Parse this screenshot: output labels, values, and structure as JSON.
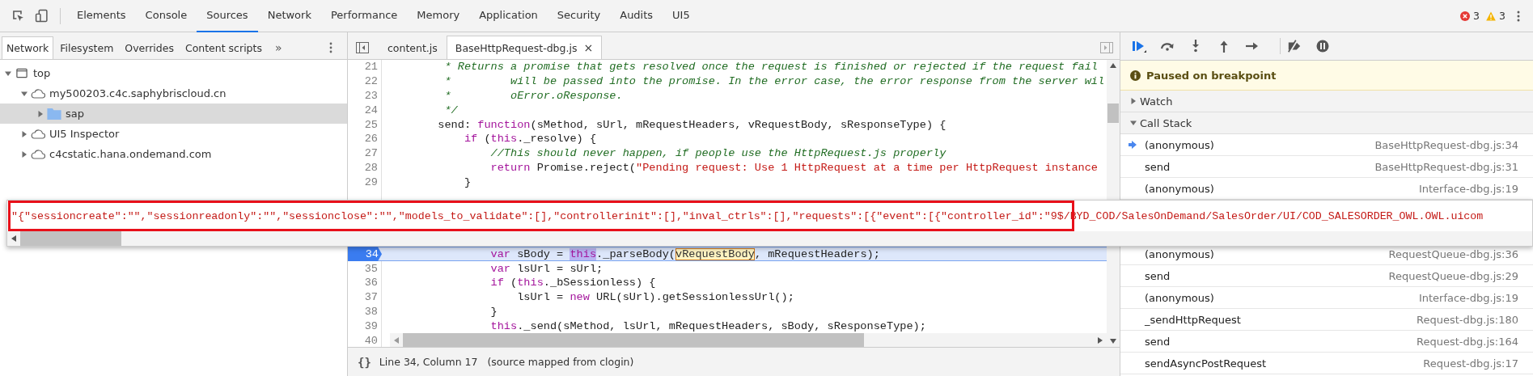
{
  "toolbar": {
    "tabs": [
      {
        "label": "Elements",
        "selected": false
      },
      {
        "label": "Console",
        "selected": false
      },
      {
        "label": "Sources",
        "selected": true
      },
      {
        "label": "Network",
        "selected": false
      },
      {
        "label": "Performance",
        "selected": false
      },
      {
        "label": "Memory",
        "selected": false
      },
      {
        "label": "Application",
        "selected": false
      },
      {
        "label": "Security",
        "selected": false
      },
      {
        "label": "Audits",
        "selected": false
      },
      {
        "label": "UI5",
        "selected": false
      }
    ],
    "errors": "3",
    "warnings": "3"
  },
  "navigator": {
    "tabs": [
      {
        "label": "Network",
        "selected": true
      },
      {
        "label": "Filesystem",
        "selected": false
      },
      {
        "label": "Overrides",
        "selected": false
      },
      {
        "label": "Content scripts",
        "selected": false
      }
    ],
    "more": "»",
    "tree": [
      {
        "label": "top",
        "kind": "frame",
        "expanded": true,
        "selected": false,
        "children": [
          {
            "label": "my500203.c4c.saphybriscloud.cn",
            "kind": "domain",
            "expanded": true,
            "selected": false,
            "children": [
              {
                "label": "sap",
                "kind": "folder",
                "expanded": false,
                "selected": true
              }
            ]
          },
          {
            "label": "UI5 Inspector",
            "kind": "domain",
            "expanded": false,
            "selected": false
          },
          {
            "label": "c4cstatic.hana.ondemand.com",
            "kind": "domain",
            "expanded": false,
            "selected": false
          }
        ]
      }
    ]
  },
  "editor": {
    "tabs": [
      {
        "label": "content.js",
        "selected": false,
        "closable": false
      },
      {
        "label": "BaseHttpRequest-dbg.js",
        "selected": true,
        "closable": true
      }
    ],
    "close": "×",
    "lines_above": [
      {
        "number": "21",
        "paused": false,
        "segments": [
          {
            "kind": "comment",
            "text": "         * Returns a promise that gets resolved once the request is finished or rejected if the request fail"
          }
        ]
      },
      {
        "number": "22",
        "paused": false,
        "segments": [
          {
            "kind": "comment",
            "text": "         *         will be passed into the promise. In the error case, the error response from the server wil"
          }
        ]
      },
      {
        "number": "23",
        "paused": false,
        "segments": [
          {
            "kind": "comment",
            "text": "         *         oError.oResponse."
          }
        ]
      },
      {
        "number": "24",
        "paused": false,
        "segments": [
          {
            "kind": "comment",
            "text": "         */"
          }
        ]
      },
      {
        "number": "25",
        "paused": false,
        "segments": [
          {
            "kind": "plain",
            "text": "        send: "
          },
          {
            "kind": "keyword",
            "text": "function"
          },
          {
            "kind": "plain",
            "text": "(sMethod, sUrl, mRequestHeaders, vRequestBody, sResponseType) {"
          }
        ]
      },
      {
        "number": "26",
        "paused": false,
        "segments": [
          {
            "kind": "keyword",
            "text": "            if"
          },
          {
            "kind": "plain",
            "text": " ("
          },
          {
            "kind": "keyword",
            "text": "this"
          },
          {
            "kind": "plain",
            "text": "._resolve) {"
          }
        ]
      },
      {
        "number": "27",
        "paused": false,
        "segments": [
          {
            "kind": "comment",
            "text": "                //This should never happen, if people use the HttpRequest.js properly"
          }
        ]
      },
      {
        "number": "28",
        "paused": false,
        "segments": [
          {
            "kind": "keyword",
            "text": "                return"
          },
          {
            "kind": "plain",
            "text": " Promise.reject("
          },
          {
            "kind": "string",
            "text": "\"Pending request: Use 1 HttpRequest at a time per HttpRequest instance"
          }
        ]
      },
      {
        "number": "29",
        "paused": false,
        "segments": [
          {
            "kind": "plain",
            "text": "            }"
          }
        ]
      }
    ],
    "lines_below": [
      {
        "number": "34",
        "paused": true,
        "segments": [
          {
            "kind": "keyword",
            "text": "                var"
          },
          {
            "kind": "plain",
            "text": " sBody = "
          },
          {
            "kind": "match",
            "text": "this"
          },
          {
            "kind": "plain",
            "text": "._parseBody("
          },
          {
            "kind": "hover",
            "text": "vRequestBody"
          },
          {
            "kind": "plain",
            "text": ", mRequestHeaders);"
          }
        ]
      },
      {
        "number": "35",
        "paused": false,
        "segments": [
          {
            "kind": "keyword",
            "text": "                var"
          },
          {
            "kind": "plain",
            "text": " lsUrl = sUrl;"
          }
        ]
      },
      {
        "number": "36",
        "paused": false,
        "segments": [
          {
            "kind": "keyword",
            "text": "                if"
          },
          {
            "kind": "plain",
            "text": " ("
          },
          {
            "kind": "keyword",
            "text": "this"
          },
          {
            "kind": "plain",
            "text": "._bSessionless) {"
          }
        ]
      },
      {
        "number": "37",
        "paused": false,
        "segments": [
          {
            "kind": "plain",
            "text": "                    lsUrl = "
          },
          {
            "kind": "keyword",
            "text": "new"
          },
          {
            "kind": "plain",
            "text": " URL(sUrl).getSessionlessUrl();"
          }
        ]
      },
      {
        "number": "38",
        "paused": false,
        "segments": [
          {
            "kind": "plain",
            "text": "                }"
          }
        ]
      },
      {
        "number": "39",
        "paused": false,
        "segments": [
          {
            "kind": "keyword",
            "text": "                this"
          },
          {
            "kind": "plain",
            "text": "._send(sMethod, lsUrl, mRequestHeaders, sBody, sResponseType);"
          }
        ]
      },
      {
        "number": "40",
        "paused": false
      }
    ],
    "status": {
      "format": "{}",
      "position": "Line 34, Column 17",
      "source": "(source mapped from clogin)"
    }
  },
  "debugger": {
    "banner": "Paused on breakpoint",
    "sections": [
      {
        "label": "Watch",
        "expanded": false
      },
      {
        "label": "Call Stack",
        "expanded": true
      }
    ],
    "call_stack_above": [
      {
        "function": "(anonymous)",
        "location": "BaseHttpRequest-dbg.js:34",
        "current": true
      },
      {
        "function": "send",
        "location": "BaseHttpRequest-dbg.js:31",
        "current": false
      },
      {
        "function": "(anonymous)",
        "location": "Interface-dbg.js:19",
        "current": false
      }
    ],
    "call_stack_below": [
      {
        "function": "(anonymous)",
        "location": "RequestQueue-dbg.js:36",
        "current": false
      },
      {
        "function": "send",
        "location": "RequestQueue-dbg.js:29",
        "current": false
      },
      {
        "function": "(anonymous)",
        "location": "Interface-dbg.js:19",
        "current": false
      },
      {
        "function": "_sendHttpRequest",
        "location": "Request-dbg.js:180",
        "current": false
      },
      {
        "function": "send",
        "location": "Request-dbg.js:164",
        "current": false
      },
      {
        "function": "sendAsyncPostRequest",
        "location": "Request-dbg.js:17",
        "current": false
      }
    ]
  },
  "popover": {
    "value": "\"{\"sessioncreate\":\"\",\"sessionreadonly\":\"\",\"sessionclose\":\"\",\"models_to_validate\":[],\"controllerinit\":[],\"inval_ctrls\":[],\"requests\":[{\"event\":[{\"controller_id\":\"9$/BYD_COD/SalesOnDemand/SalesOrder/UI/COD_SALESORDER_OWL.OWL.uicom"
  }
}
